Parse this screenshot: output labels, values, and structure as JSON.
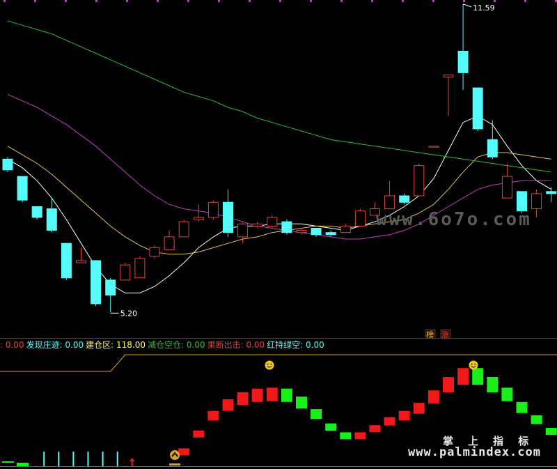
{
  "chart_data": [
    {
      "type": "candlestick",
      "price_labels": {
        "high": "11.59",
        "low": "5.20"
      },
      "badges": [
        "榜",
        "涨"
      ],
      "colors": {
        "up": "#e8413c",
        "down": "#54fcfc",
        "ma_short": "#ffffff",
        "ma_mid": "#e4c34b",
        "ma_long": "#c53cc7",
        "ma_longest": "#2ebd3a"
      },
      "candles": [
        {
          "o": 8.0,
          "h": 8.05,
          "l": 7.7,
          "c": 7.75
        },
        {
          "o": 7.6,
          "h": 7.6,
          "l": 7.0,
          "c": 7.05
        },
        {
          "o": 6.9,
          "h": 6.9,
          "l": 6.6,
          "c": 6.65
        },
        {
          "o": 6.85,
          "h": 7.1,
          "l": 6.3,
          "c": 6.35
        },
        {
          "o": 6.05,
          "h": 6.05,
          "l": 5.2,
          "c": 5.25
        },
        {
          "o": 5.6,
          "h": 5.95,
          "l": 5.6,
          "c": 5.65
        },
        {
          "o": 5.65,
          "h": 5.65,
          "l": 4.6,
          "c": 4.65
        },
        {
          "o": 5.2,
          "h": 5.25,
          "l": 4.45,
          "c": 4.85
        },
        {
          "o": 5.2,
          "h": 5.6,
          "l": 5.2,
          "c": 5.55
        },
        {
          "o": 5.25,
          "h": 5.75,
          "l": 5.25,
          "c": 5.7
        },
        {
          "o": 5.75,
          "h": 6.0,
          "l": 5.7,
          "c": 5.95
        },
        {
          "o": 5.9,
          "h": 6.35,
          "l": 5.9,
          "c": 6.2
        },
        {
          "o": 6.2,
          "h": 6.6,
          "l": 6.2,
          "c": 6.55
        },
        {
          "o": 6.6,
          "h": 6.95,
          "l": 6.55,
          "c": 6.65
        },
        {
          "o": 6.65,
          "h": 7.05,
          "l": 6.6,
          "c": 7.0
        },
        {
          "o": 7.0,
          "h": 7.3,
          "l": 6.2,
          "c": 6.3
        },
        {
          "o": 6.2,
          "h": 6.55,
          "l": 6.05,
          "c": 6.5
        },
        {
          "o": 6.45,
          "h": 6.55,
          "l": 6.4,
          "c": 6.5
        },
        {
          "o": 6.45,
          "h": 6.7,
          "l": 6.4,
          "c": 6.65
        },
        {
          "o": 6.55,
          "h": 6.6,
          "l": 6.25,
          "c": 6.3
        },
        {
          "o": 6.3,
          "h": 6.4,
          "l": 6.25,
          "c": 6.35
        },
        {
          "o": 6.4,
          "h": 6.4,
          "l": 6.2,
          "c": 6.25
        },
        {
          "o": 6.3,
          "h": 6.35,
          "l": 6.2,
          "c": 6.25
        },
        {
          "o": 6.3,
          "h": 6.5,
          "l": 6.3,
          "c": 6.45
        },
        {
          "o": 6.45,
          "h": 6.85,
          "l": 6.45,
          "c": 6.8
        },
        {
          "o": 6.7,
          "h": 7.0,
          "l": 6.7,
          "c": 6.85
        },
        {
          "o": 6.85,
          "h": 7.5,
          "l": 6.85,
          "c": 7.15
        },
        {
          "o": 7.15,
          "h": 7.2,
          "l": 6.95,
          "c": 7.0
        },
        {
          "o": 7.15,
          "h": 7.9,
          "l": 7.15,
          "c": 7.85
        },
        {
          "o": 8.3,
          "h": 8.3,
          "l": 8.3,
          "c": 8.3
        },
        {
          "o": 9.9,
          "h": 9.95,
          "l": 9.0,
          "c": 9.95
        },
        {
          "o": 10.5,
          "h": 11.59,
          "l": 9.6,
          "c": 10.0
        },
        {
          "o": 9.65,
          "h": 9.65,
          "l": 8.65,
          "c": 8.7
        },
        {
          "o": 8.45,
          "h": 8.9,
          "l": 8.0,
          "c": 8.05
        },
        {
          "o": 7.1,
          "h": 7.9,
          "l": 7.1,
          "c": 7.6
        },
        {
          "o": 7.25,
          "h": 7.25,
          "l": 6.75,
          "c": 6.8
        },
        {
          "o": 6.85,
          "h": 7.3,
          "l": 6.65,
          "c": 7.2
        },
        {
          "o": 7.25,
          "h": 7.35,
          "l": 7.0,
          "c": 7.2
        }
      ],
      "ma_lines": [
        {
          "key": "ma_short",
          "values": [
            8.0,
            7.8,
            7.5,
            7.1,
            6.6,
            6.05,
            5.5,
            5.1,
            4.9,
            4.9,
            5.05,
            5.3,
            5.6,
            5.95,
            6.2,
            6.4,
            6.45,
            6.45,
            6.5,
            6.5,
            6.5,
            6.45,
            6.4,
            6.35,
            6.45,
            6.55,
            6.7,
            6.9,
            7.15,
            7.55,
            8.2,
            8.85,
            9.0,
            8.8,
            8.3,
            7.85,
            7.5,
            7.3
          ]
        },
        {
          "key": "ma_mid",
          "values": [
            8.3,
            8.1,
            7.9,
            7.65,
            7.35,
            7.05,
            6.75,
            6.45,
            6.2,
            6.0,
            5.85,
            5.8,
            5.8,
            5.85,
            5.95,
            6.05,
            6.15,
            6.2,
            6.3,
            6.35,
            6.4,
            6.45,
            6.45,
            6.4,
            6.45,
            6.5,
            6.55,
            6.6,
            6.75,
            6.95,
            7.3,
            7.7,
            8.05,
            8.15,
            8.15,
            8.1,
            8.05,
            8.0
          ]
        },
        {
          "key": "ma_long",
          "values": [
            9.5,
            9.35,
            9.2,
            9.0,
            8.8,
            8.55,
            8.3,
            8.0,
            7.7,
            7.4,
            7.15,
            6.95,
            6.85,
            6.8,
            6.75,
            6.65,
            6.55,
            6.45,
            6.4,
            6.35,
            6.3,
            6.25,
            6.2,
            6.15,
            6.15,
            6.2,
            6.25,
            6.35,
            6.5,
            6.7,
            6.9,
            7.1,
            7.3,
            7.4,
            7.45,
            7.5,
            7.5,
            7.5
          ]
        },
        {
          "key": "ma_longest",
          "values": [
            11.2,
            11.1,
            11.0,
            10.9,
            10.75,
            10.6,
            10.45,
            10.3,
            10.15,
            10.0,
            9.85,
            9.7,
            9.55,
            9.45,
            9.35,
            9.2,
            9.1,
            8.95,
            8.85,
            8.75,
            8.65,
            8.55,
            8.45,
            8.4,
            8.35,
            8.3,
            8.25,
            8.2,
            8.15,
            8.1,
            8.05,
            8.0,
            7.95,
            7.9,
            7.85,
            7.8,
            7.75,
            7.7
          ]
        }
      ]
    },
    {
      "type": "indicator",
      "values_bar": [
        {
          "label": "",
          "value": ": 0.00",
          "color": "#e8413c"
        },
        {
          "label": "发现庄迹",
          "value": ": 0.00",
          "color": "#54fcfc"
        },
        {
          "label": "建仓区",
          "value": ": 118.00",
          "color": "#ffff54"
        },
        {
          "label": "减仓空仓",
          "value": ": 0.00",
          "color": "#2ebd3a"
        },
        {
          "label": "果断出击",
          "value": ": 0.00",
          "color": "#e8413c"
        },
        {
          "label": "红持绿空",
          "value": ": 0.00",
          "color": "#54fcfc"
        }
      ],
      "step_values": [
        44,
        44,
        44,
        44,
        44,
        44,
        44,
        44,
        80,
        80,
        80,
        80,
        80,
        80,
        80,
        80,
        80,
        80,
        80,
        80,
        80,
        80,
        80,
        80,
        80,
        80,
        80,
        80,
        80,
        80,
        80,
        80,
        80,
        80,
        80,
        80,
        80,
        80
      ],
      "blocks": [
        {
          "v": 6,
          "d": "up"
        },
        {
          "v": 6,
          "d": "up"
        },
        {
          "v": 6,
          "d": "up"
        },
        {
          "v": 6,
          "d": "up"
        },
        {
          "v": 6,
          "d": "up"
        },
        {
          "v": 6,
          "d": "up"
        },
        {
          "v": 6,
          "d": "up"
        },
        {
          "v": 6,
          "d": "up"
        },
        {
          "v": 6,
          "d": "up"
        },
        {
          "v": 6,
          "d": "up"
        },
        {
          "v": 6,
          "d": "up"
        },
        {
          "v": 6,
          "d": "up"
        },
        {
          "v": 20,
          "d": "up"
        },
        {
          "v": 40,
          "d": "up"
        },
        {
          "v": 62,
          "d": "up"
        },
        {
          "v": 75,
          "d": "up"
        },
        {
          "v": 83,
          "d": "up"
        },
        {
          "v": 87,
          "d": "up"
        },
        {
          "v": 88,
          "d": "up"
        },
        {
          "v": 87,
          "d": "down"
        },
        {
          "v": 78,
          "d": "down"
        },
        {
          "v": 64,
          "d": "down"
        },
        {
          "v": 48,
          "d": "down"
        },
        {
          "v": 38,
          "d": "down"
        },
        {
          "v": 38,
          "d": "up"
        },
        {
          "v": 46,
          "d": "up"
        },
        {
          "v": 55,
          "d": "up"
        },
        {
          "v": 62,
          "d": "up"
        },
        {
          "v": 71,
          "d": "up"
        },
        {
          "v": 85,
          "d": "up"
        },
        {
          "v": 100,
          "d": "up"
        },
        {
          "v": 110,
          "d": "up"
        },
        {
          "v": 110,
          "d": "down"
        },
        {
          "v": 100,
          "d": "down"
        },
        {
          "v": 88,
          "d": "down"
        },
        {
          "v": 72,
          "d": "down"
        },
        {
          "v": 57,
          "d": "down"
        },
        {
          "v": 43,
          "d": "down"
        }
      ],
      "cyan_spikes": [
        2,
        3,
        4,
        5,
        6,
        7
      ],
      "smiley_icons": [
        "smiley-icon",
        "smiley-icon"
      ],
      "arrow_icon": "up-arrow-icon",
      "signal_icon": "buy-signal-icon"
    }
  ],
  "watermarks": {
    "main": "www.6o7o.com",
    "sub1": "掌 上 指 标",
    "sub2": "www.palmindex.com"
  }
}
